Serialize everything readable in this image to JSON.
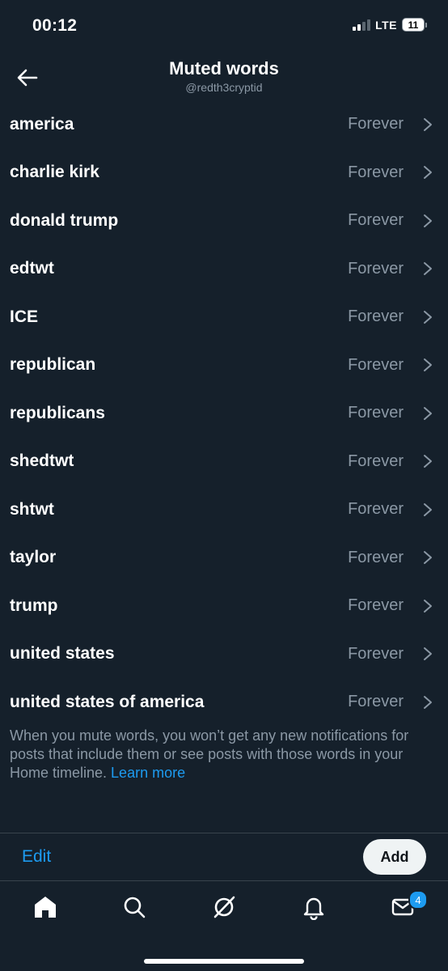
{
  "status": {
    "time": "00:12",
    "network": "LTE",
    "battery": "11"
  },
  "header": {
    "title": "Muted words",
    "handle": "@redth3cryptid"
  },
  "muted_words": [
    {
      "word": "america",
      "duration": "Forever"
    },
    {
      "word": "charlie kirk",
      "duration": "Forever"
    },
    {
      "word": "donald trump",
      "duration": "Forever"
    },
    {
      "word": "edtwt",
      "duration": "Forever"
    },
    {
      "word": "ICE",
      "duration": "Forever"
    },
    {
      "word": "republican",
      "duration": "Forever"
    },
    {
      "word": "republicans",
      "duration": "Forever"
    },
    {
      "word": "shedtwt",
      "duration": "Forever"
    },
    {
      "word": "shtwt",
      "duration": "Forever"
    },
    {
      "word": "taylor",
      "duration": "Forever"
    },
    {
      "word": "trump",
      "duration": "Forever"
    },
    {
      "word": "united states",
      "duration": "Forever"
    },
    {
      "word": "united states of america",
      "duration": "Forever"
    }
  ],
  "note": {
    "text": "When you mute words, you won’t get any new notifications for posts that include them or see posts with those words in your Home timeline. ",
    "link": "Learn more"
  },
  "footer": {
    "edit_label": "Edit",
    "add_label": "Add"
  },
  "tabs": {
    "items": [
      "home-icon",
      "search-icon",
      "grok-icon",
      "notifications-icon",
      "messages-icon"
    ],
    "messages_badge": "4"
  },
  "colors": {
    "background": "#15202b",
    "accent": "#1d9bf0",
    "muted_text": "#8b98a5"
  }
}
